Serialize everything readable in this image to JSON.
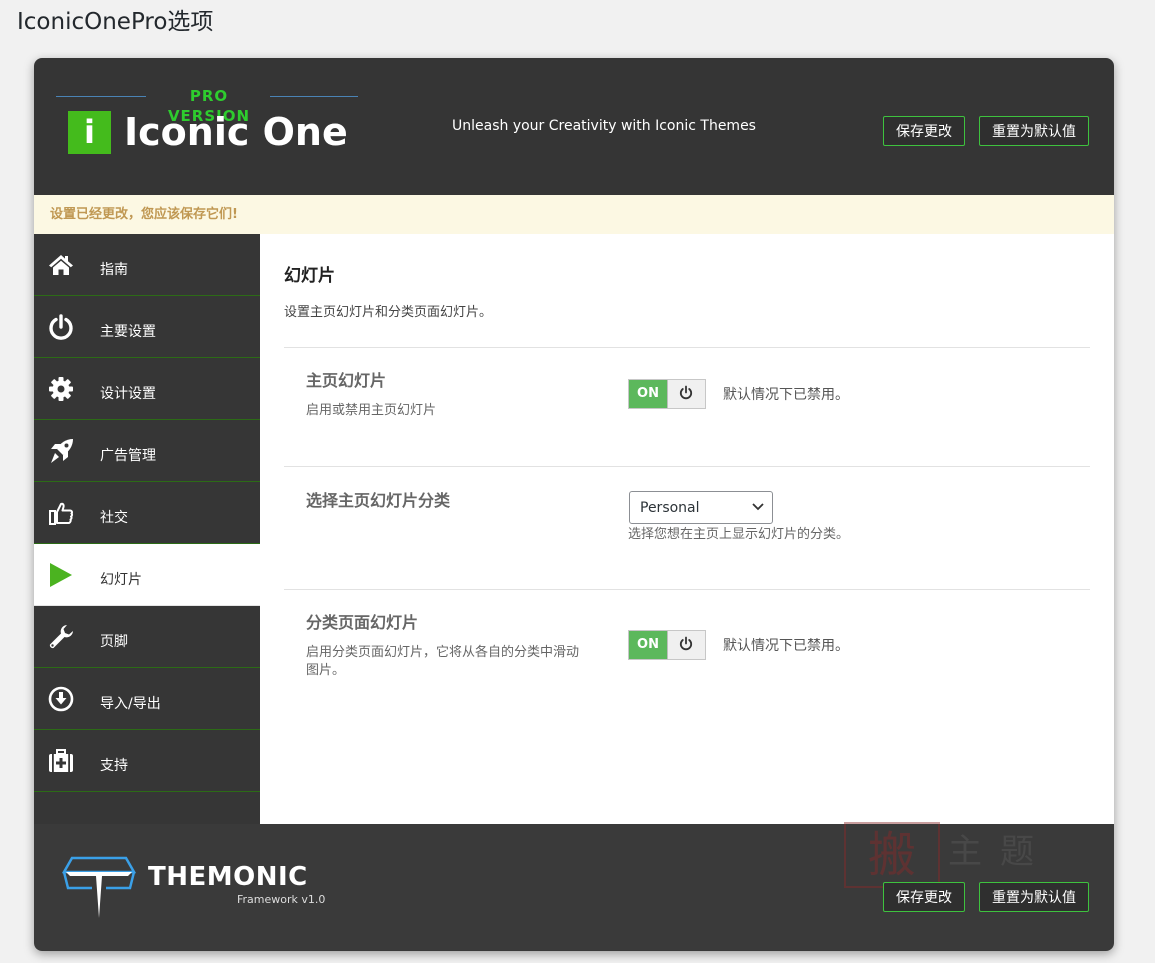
{
  "page": {
    "title": "IconicOnePro选项"
  },
  "header": {
    "logo_pro": "PRO VERSION",
    "logo_badge": "i",
    "logo_name": "Iconic One",
    "tagline": "Unleash your Creativity with Iconic Themes",
    "save_label": "保存更改",
    "reset_label": "重置为默认值"
  },
  "notice": {
    "text": "设置已经更改，您应该保存它们!"
  },
  "sidebar": {
    "items": [
      {
        "label": "指南",
        "icon": "home-icon"
      },
      {
        "label": "主要设置",
        "icon": "power-icon"
      },
      {
        "label": "设计设置",
        "icon": "gear-icon"
      },
      {
        "label": "广告管理",
        "icon": "rocket-icon"
      },
      {
        "label": "社交",
        "icon": "thumbs-up-icon"
      },
      {
        "label": "幻灯片",
        "icon": "play-icon",
        "active": true
      },
      {
        "label": "页脚",
        "icon": "wrench-icon"
      },
      {
        "label": "导入/导出",
        "icon": "download-icon"
      },
      {
        "label": "支持",
        "icon": "first-aid-icon"
      }
    ]
  },
  "content": {
    "title": "幻灯片",
    "desc": "设置主页幻灯片和分类页面幻灯片。",
    "fields": [
      {
        "label": "主页幻灯片",
        "sub": "启用或禁用主页幻灯片",
        "switch_label": "ON",
        "note": "默认情况下已禁用。"
      },
      {
        "label": "选择主页幻灯片分类",
        "select_value": "Personal",
        "note": "选择您想在主页上显示幻灯片的分类。"
      },
      {
        "label": "分类页面幻灯片",
        "sub": "启用分类页面幻灯片，它将从各自的分类中滑动图片。",
        "switch_label": "ON",
        "note": "默认情况下已禁用。"
      }
    ]
  },
  "footer": {
    "brand_name": "THEMONIC",
    "brand_sub": "Framework v1.0",
    "save_label": "保存更改",
    "reset_label": "重置为默认值",
    "watermark_stamp": "搬",
    "watermark_text": "主题"
  },
  "colors": {
    "accent_green": "#3ec23e",
    "header_bg": "#353535",
    "switch_on": "#5cb85c",
    "notice_bg": "#fcf8e3"
  }
}
